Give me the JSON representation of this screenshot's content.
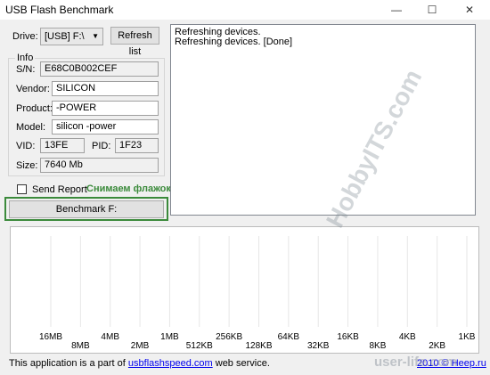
{
  "window": {
    "title": "USB Flash Benchmark",
    "controls": {
      "minimize": "—",
      "maximize": "☐",
      "close": "✕"
    }
  },
  "drive": {
    "label": "Drive:",
    "selected": "[USB] F:\\",
    "refresh_label": "Refresh list"
  },
  "info": {
    "legend": "Info",
    "sn_label": "S/N:",
    "sn": "E68C0B002CEF",
    "vendor_label": "Vendor:",
    "vendor": "SILICON",
    "product_label": "Product:",
    "product": "-POWER",
    "model_label": "Model:",
    "model": "silicon -power",
    "vid_label": "VID:",
    "vid": "13FE",
    "pid_label": "PID:",
    "pid": "1F23",
    "size_label": "Size:",
    "size": "7640 Mb"
  },
  "send_report": {
    "label": "Send Report",
    "checked": false
  },
  "annotation": {
    "text": "Снимаем флажок",
    "color": "#3b8a3b"
  },
  "benchmark_button": {
    "label": "Benchmark F:"
  },
  "log": {
    "lines": [
      "Refreshing devices.",
      "Refreshing devices. [Done]"
    ]
  },
  "chart_data": {
    "type": "bar",
    "categories": [
      "16MB",
      "8MB",
      "4MB",
      "2MB",
      "1MB",
      "512KB",
      "256KB",
      "128KB",
      "64KB",
      "32KB",
      "16KB",
      "8KB",
      "4KB",
      "2KB",
      "1KB"
    ],
    "series": [],
    "grid": true
  },
  "footer": {
    "prefix": "This application is a part of ",
    "link": "usbflashspeed.com",
    "suffix": " web service.",
    "copyright": "2010 © Heep.ru"
  },
  "watermark": {
    "text": "HobbyITS.com",
    "text2": "user-life.com"
  }
}
